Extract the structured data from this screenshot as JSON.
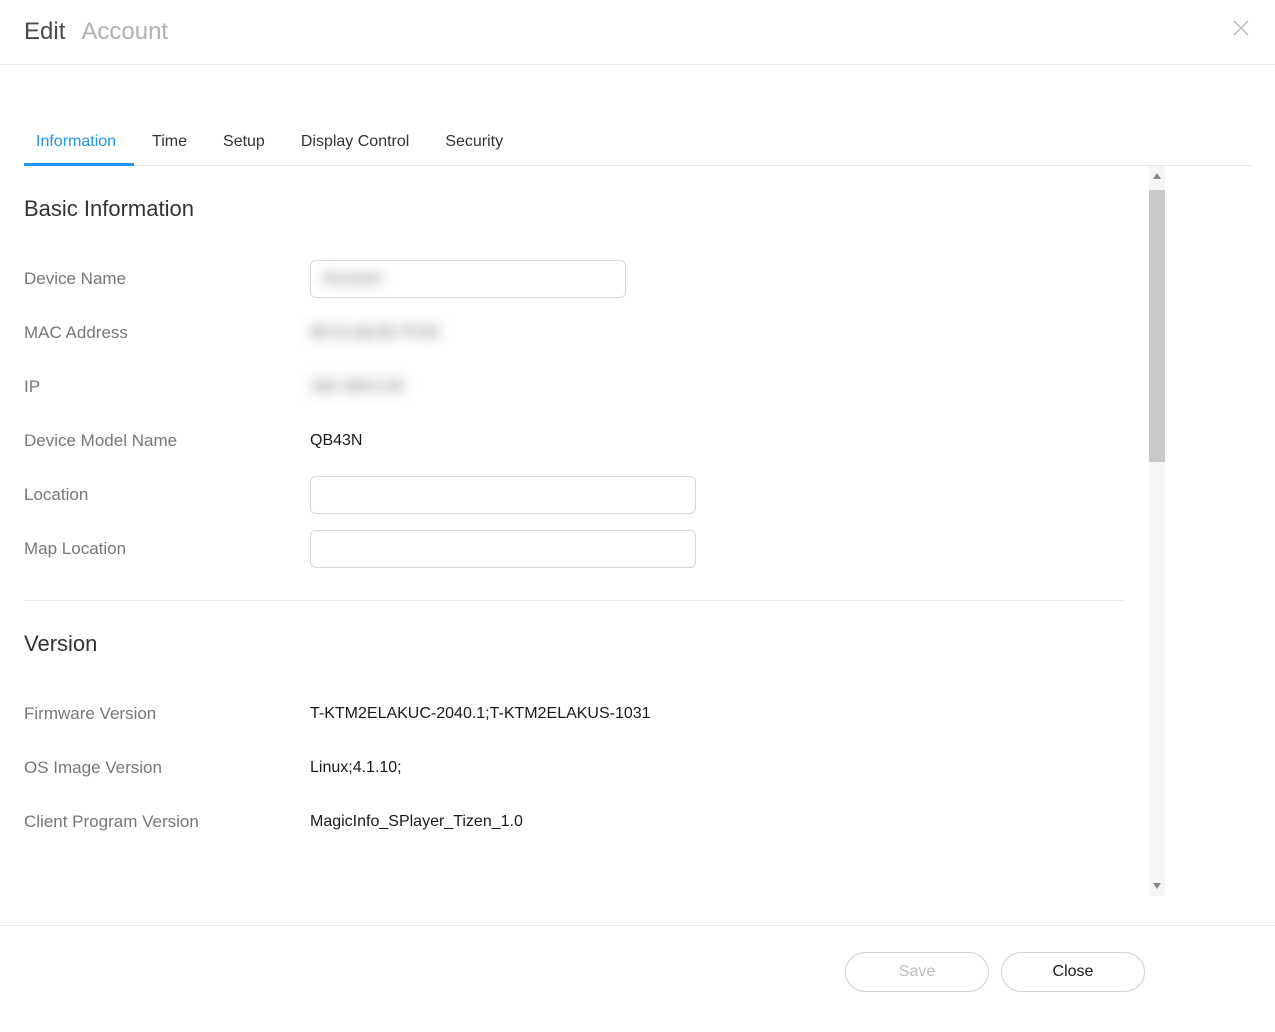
{
  "header": {
    "edit_label": "Edit",
    "account_label": "Account"
  },
  "tabs": {
    "information": "Information",
    "time": "Time",
    "setup": "Setup",
    "display_control": "Display Control",
    "security": "Security",
    "active": "information"
  },
  "sections": {
    "basic_info": {
      "title": "Basic Information",
      "device_name": {
        "label": "Device Name",
        "value": "Account"
      },
      "mac_address": {
        "label": "MAC Address",
        "value": "00:12:ab:00:75:50"
      },
      "ip": {
        "label": "IP",
        "value": "192.168.0.20"
      },
      "device_model_name": {
        "label": "Device Model Name",
        "value": "QB43N"
      },
      "location": {
        "label": "Location",
        "value": ""
      },
      "map_location": {
        "label": "Map Location",
        "value": ""
      }
    },
    "version": {
      "title": "Version",
      "firmware_version": {
        "label": "Firmware Version",
        "value": "T-KTM2ELAKUC-2040.1;T-KTM2ELAKUS-1031"
      },
      "os_image_version": {
        "label": "OS Image Version",
        "value": "Linux;4.1.10;"
      },
      "client_program_version": {
        "label": "Client Program Version",
        "value": "MagicInfo_SPlayer_Tizen_1.0"
      }
    }
  },
  "footer": {
    "save_label": "Save",
    "close_label": "Close"
  }
}
